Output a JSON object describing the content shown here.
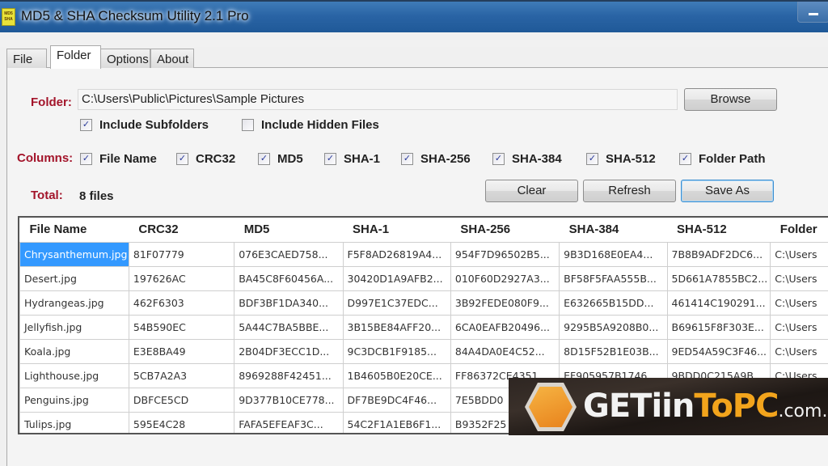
{
  "window": {
    "title": "MD5 & SHA Checksum Utility 2.1 Pro",
    "icon_text_top": "MD5",
    "icon_text_bottom": "SHA"
  },
  "tabs": [
    {
      "label": "File",
      "active": false
    },
    {
      "label": "Folder",
      "active": true
    },
    {
      "label": "Options",
      "active": false
    },
    {
      "label": "About",
      "active": false
    }
  ],
  "folder": {
    "label": "Folder:",
    "path": "C:\\Users\\Public\\Pictures\\Sample Pictures",
    "browse_label": "Browse",
    "include_subfolders": {
      "label": "Include Subfolders",
      "checked": true
    },
    "include_hidden": {
      "label": "Include Hidden Files",
      "checked": false
    }
  },
  "columns": {
    "label": "Columns:",
    "options": [
      {
        "label": "File Name",
        "checked": true
      },
      {
        "label": "CRC32",
        "checked": true
      },
      {
        "label": "MD5",
        "checked": true
      },
      {
        "label": "SHA-1",
        "checked": true
      },
      {
        "label": "SHA-256",
        "checked": true
      },
      {
        "label": "SHA-384",
        "checked": true
      },
      {
        "label": "SHA-512",
        "checked": true
      },
      {
        "label": "Folder Path",
        "checked": true
      }
    ]
  },
  "total": {
    "label": "Total:",
    "value": "8 files"
  },
  "actions": {
    "clear": "Clear",
    "refresh": "Refresh",
    "save_as": "Save As"
  },
  "grid": {
    "headers": [
      "File Name",
      "CRC32",
      "MD5",
      "SHA-1",
      "SHA-256",
      "SHA-384",
      "SHA-512",
      "Folder"
    ],
    "rows": [
      [
        "Chrysanthemum.jpg",
        "81F07779",
        "076E3CAED758...",
        "F5F8AD26819A4...",
        "954F7D96502B5...",
        "9B3D168E0EA4...",
        "7B8B9ADF2DC6...",
        "C:\\Users"
      ],
      [
        "Desert.jpg",
        "197626AC",
        "BA45C8F60456A...",
        "30420D1A9AFB2...",
        "010F60D2927A3...",
        "BF58F5FAA555B...",
        "5D661A7855BC2...",
        "C:\\Users"
      ],
      [
        "Hydrangeas.jpg",
        "462F6303",
        "BDF3BF1DA340...",
        "D997E1C37EDC...",
        "3B92FEDE080F9...",
        "E632665B15DD...",
        "461414C190291...",
        "C:\\Users"
      ],
      [
        "Jellyfish.jpg",
        "54B590EC",
        "5A44C7BA5BBE...",
        "3B15BE84AFF20...",
        "6CA0EAFB20496...",
        "9295B5A9208B0...",
        "B69615F8F303E...",
        "C:\\Users"
      ],
      [
        "Koala.jpg",
        "E3E8BA49",
        "2B04DF3ECC1D...",
        "9C3DCB1F9185...",
        "84A4DA0E4C52...",
        "8D15F52B1E03B...",
        "9ED54A59C3F46...",
        "C:\\Users"
      ],
      [
        "Lighthouse.jpg",
        "5CB7A2A3",
        "8969288F42451...",
        "1B4605B0E20CE...",
        "FF86372CE4351...",
        "EF905957B1746...",
        "9BDD0C215A9B...",
        "C:\\Users"
      ],
      [
        "Penguins.jpg",
        "DBFCE5CD",
        "9D377B10CE778...",
        "DF7BE9DC4F46...",
        "7E5BDD0",
        "",
        "",
        ""
      ],
      [
        "Tulips.jpg",
        "595E4C28",
        "FAFA5EFEAF3C...",
        "54C2F1A1EB6F1...",
        "B9352F25",
        "",
        "",
        ""
      ]
    ],
    "selected_row": 0
  },
  "watermark": {
    "text_white": "GETiin",
    "text_orange": "ToPC",
    "domain": ".com.pk"
  },
  "colors": {
    "label_red": "#a3142a",
    "selection_blue": "#3399ff",
    "watermark_orange": "#f2a41c"
  }
}
